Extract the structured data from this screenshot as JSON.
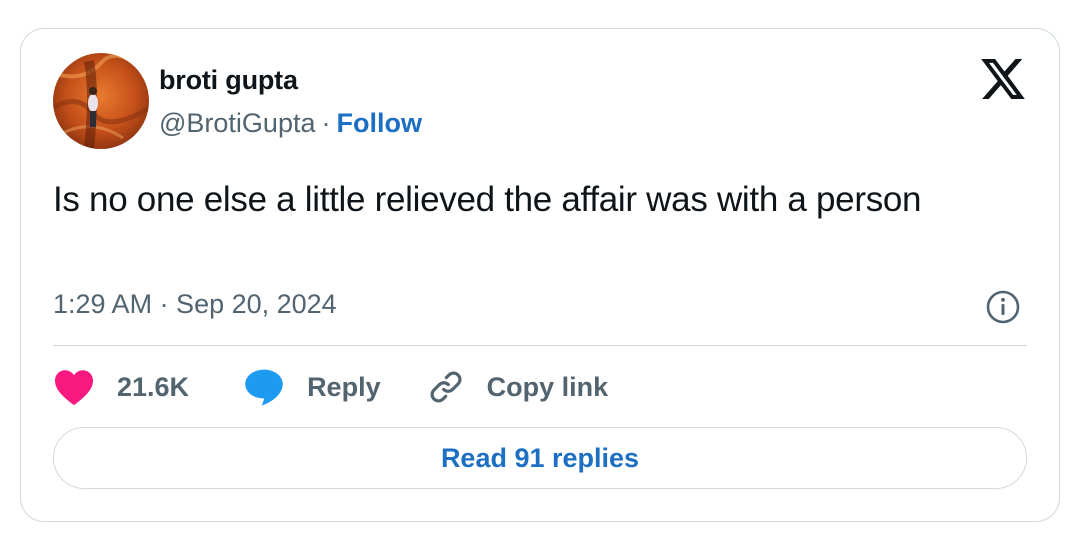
{
  "author": {
    "name": "broti gupta",
    "handle": "@BrotiGupta",
    "separator": "·",
    "follow_label": "Follow"
  },
  "tweet": {
    "text": "Is no one else a little relieved the affair was with a person",
    "timestamp": "1:29 AM · Sep 20, 2024"
  },
  "actions": {
    "like_count": "21.6K",
    "reply_label": "Reply",
    "copy_link_label": "Copy link"
  },
  "footer": {
    "read_replies_label": "Read 91 replies"
  },
  "icons": {
    "brand": "x-logo-icon",
    "info": "info-icon",
    "like": "heart-icon",
    "reply": "speech-bubble-icon",
    "copy": "link-icon"
  },
  "colors": {
    "follow_link": "#1d6fc4",
    "heart": "#f91880",
    "reply_bubble": "#1d9bf0",
    "secondary_text": "#536471",
    "border": "#cfd9de"
  }
}
